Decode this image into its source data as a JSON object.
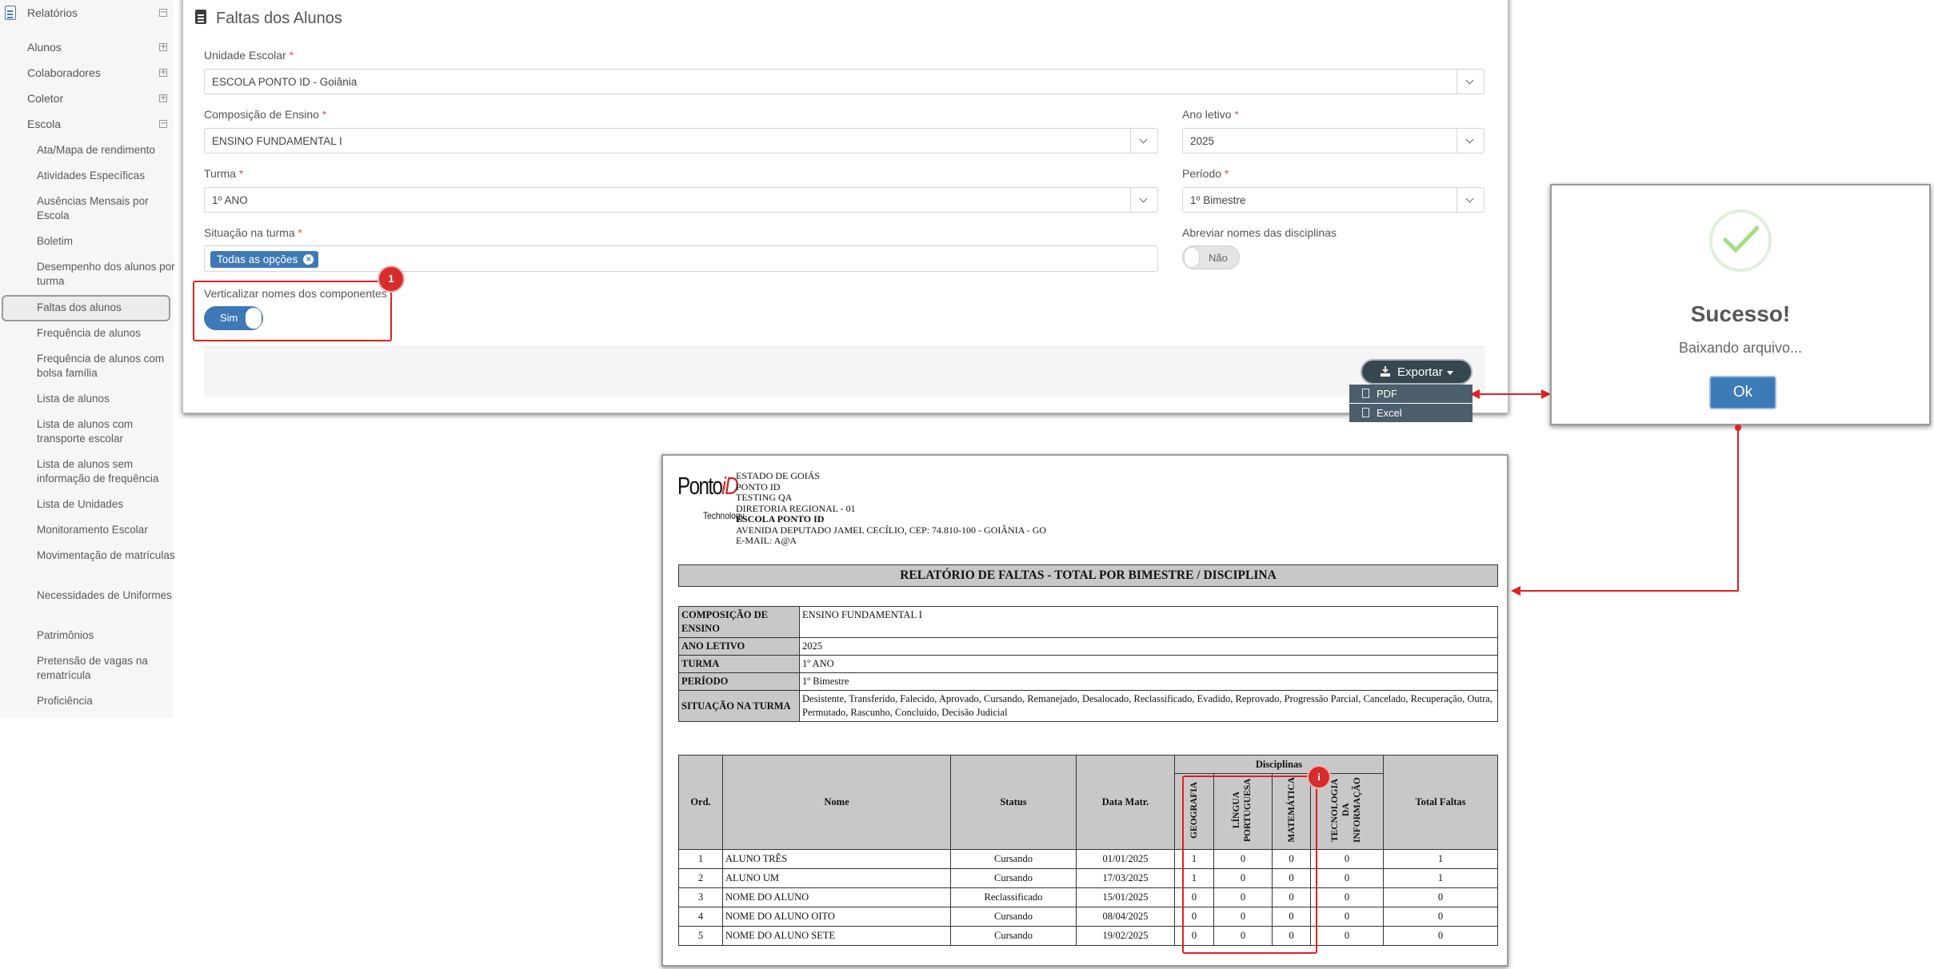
{
  "sidebar": {
    "section_label": "Relatórios",
    "groups": [
      {
        "label": "Alunos",
        "symbol": "+"
      },
      {
        "label": "Colaboradores",
        "symbol": "+"
      },
      {
        "label": "Coletor",
        "symbol": "+"
      },
      {
        "label": "Escola",
        "symbol": "−"
      }
    ],
    "items": [
      "Ata/Mapa de rendimento",
      "Atividades Específicas",
      "Ausências Mensais por Escola",
      "Boletim",
      "Desempenho dos alunos por turma",
      "Faltas dos alunos",
      "Frequência de alunos",
      "Frequência de alunos com bolsa família",
      "Lista de alunos",
      "Lista de alunos com transporte escolar",
      "Lista de alunos sem informação de frequência",
      "Lista de Unidades",
      "Monitoramento Escolar",
      "Movimentação de matrículas",
      "Necessidades de Uniformes",
      "Patrimônios",
      "Pretensão de vagas na rematrícula",
      "Proficiência"
    ],
    "active_item": "Faltas dos alunos"
  },
  "form": {
    "title": "Faltas dos Alunos",
    "required_mark": "*",
    "unidade": {
      "label": "Unidade Escolar",
      "value": "ESCOLA PONTO ID - Goiânia"
    },
    "composicao": {
      "label": "Composição de Ensino",
      "value": "ENSINO FUNDAMENTAL I"
    },
    "ano": {
      "label": "Ano letivo",
      "value": "2025"
    },
    "turma": {
      "label": "Turma",
      "value": "1º ANO"
    },
    "periodo": {
      "label": "Período",
      "value": "1º Bimestre"
    },
    "situacao": {
      "label": "Situação na turma",
      "tag": "Todas as opções",
      "tag_remove": "×"
    },
    "abreviar": {
      "label": "Abreviar nomes das disciplinas",
      "toggle": "Não"
    },
    "verticalizar": {
      "label": "Verticalizar nomes dos componentes",
      "toggle": "Sim"
    },
    "export": {
      "label": "Exportar",
      "options": [
        "PDF",
        "Excel"
      ]
    }
  },
  "annotation": {
    "badge1": "1",
    "badge_i": "i"
  },
  "dialog": {
    "title": "Sucesso!",
    "text": "Baixando arquivo...",
    "ok": "Ok"
  },
  "report": {
    "logo": {
      "brand": "Ponto",
      "brand_id": "iD",
      "tagline": "Technology"
    },
    "header_lines": [
      "ESTADO DE GOIÁS",
      "PONTO ID",
      "TESTING QA",
      "DIRETORIA REGIONAL - 01",
      "ESCOLA PONTO ID",
      "AVENIDA DEPUTADO JAMEL CECÍLIO, CEP: 74.810-100 - GOIÂNIA - GO",
      "E-MAIL: A@A"
    ],
    "title": "RELATÓRIO DE FALTAS - TOTAL POR BIMESTRE / DISCIPLINA",
    "info": [
      {
        "key": "COMPOSIÇÃO DE ENSINO",
        "value": "ENSINO FUNDAMENTAL I"
      },
      {
        "key": "ANO LETIVO",
        "value": "2025"
      },
      {
        "key": "TURMA",
        "value": "1º ANO"
      },
      {
        "key": "PERÍODO",
        "value": "1º Bimestre"
      },
      {
        "key": "SITUAÇÃO NA TURMA",
        "value": "Desistente, Transferido, Falecido, Aprovado, Cursando, Remanejado, Desalocado, Reclassificado, Evadido, Reprovado, Progressão Parcial, Cancelado, Recuperação, Outra, Permutado, Rascunho, Concluído, Decisão Judicial"
      }
    ],
    "table": {
      "headers": {
        "ord": "Ord.",
        "nome": "Nome",
        "status": "Status",
        "data": "Data Matr.",
        "disciplinas": "Disciplinas",
        "total": "Total Faltas"
      },
      "disciplines": [
        "GEOGRAFIA",
        "LÍNGUA PORTUGUESA",
        "MATEMÁTICA",
        "TECNOLOGIA DA INFORMAÇÃO"
      ],
      "rows": [
        {
          "ord": "1",
          "nome": "ALUNO TRÊS",
          "status": "Cursando",
          "data": "01/01/2025",
          "d": [
            "1",
            "0",
            "0",
            "0"
          ],
          "total": "1"
        },
        {
          "ord": "2",
          "nome": "ALUNO UM",
          "status": "Cursando",
          "data": "17/03/2025",
          "d": [
            "1",
            "0",
            "0",
            "0"
          ],
          "total": "1"
        },
        {
          "ord": "3",
          "nome": "NOME DO ALUNO",
          "status": "Reclassificado",
          "data": "15/01/2025",
          "d": [
            "0",
            "0",
            "0",
            "0"
          ],
          "total": "0"
        },
        {
          "ord": "4",
          "nome": "NOME DO ALUNO OITO",
          "status": "Cursando",
          "data": "08/04/2025",
          "d": [
            "0",
            "0",
            "0",
            "0"
          ],
          "total": "0"
        },
        {
          "ord": "5",
          "nome": "NOME DO ALUNO SETE",
          "status": "Cursando",
          "data": "19/02/2025",
          "d": [
            "0",
            "0",
            "0",
            "0"
          ],
          "total": "0"
        }
      ]
    }
  }
}
